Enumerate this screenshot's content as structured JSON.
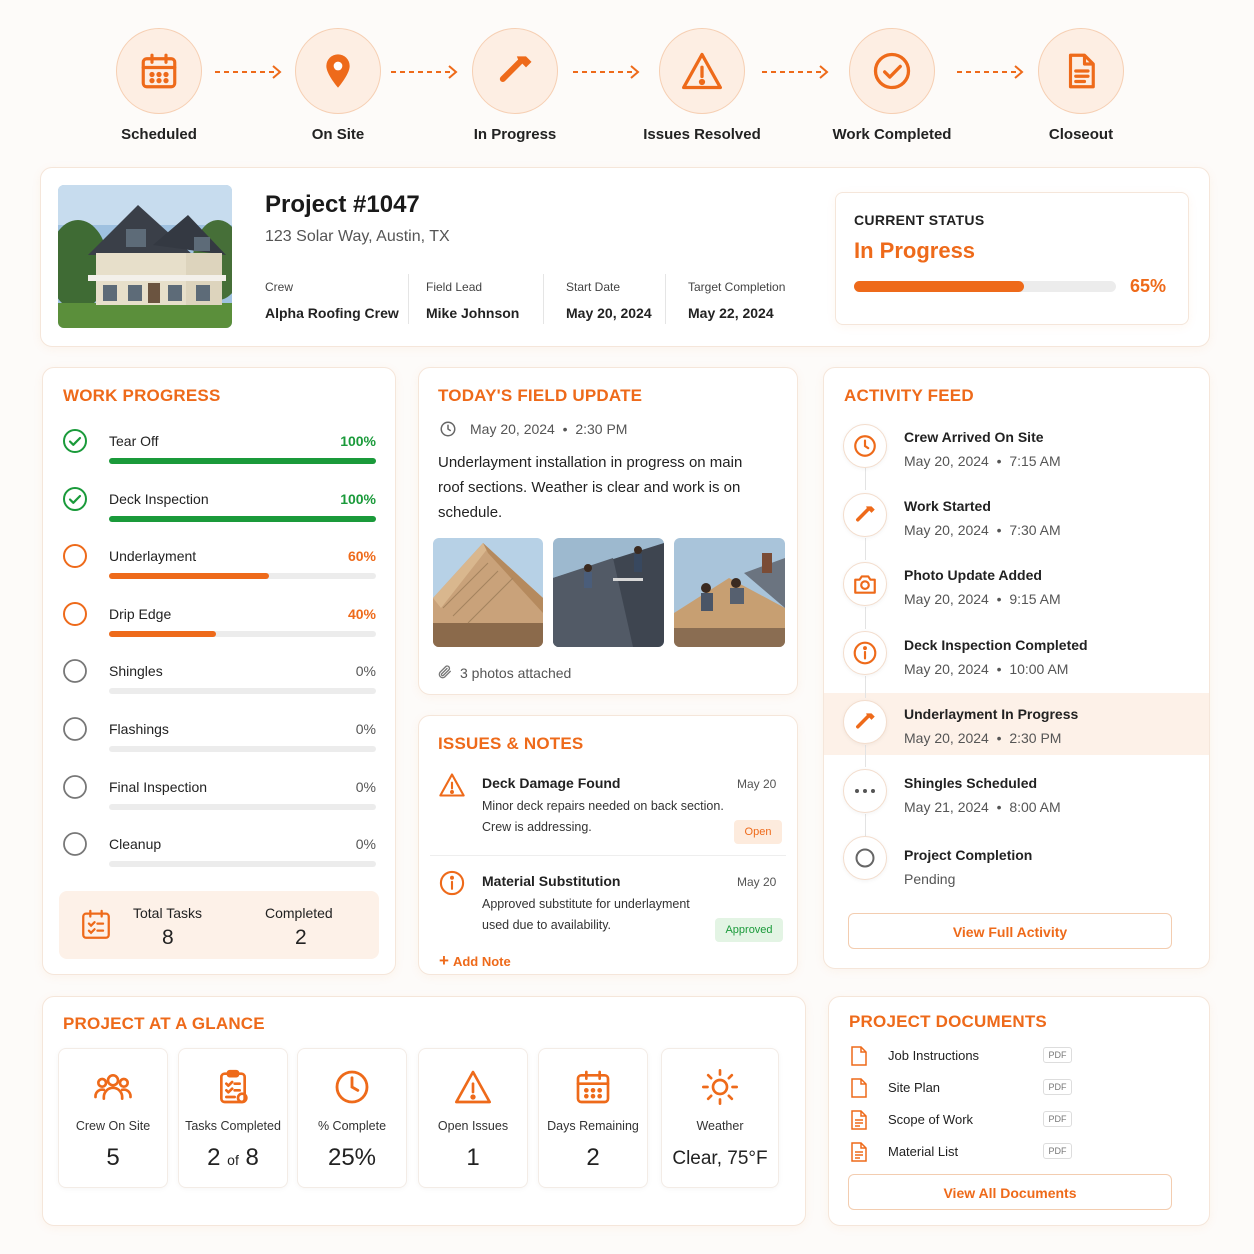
{
  "colors": {
    "accent": "#ee6a1a",
    "success": "#1a9a3a",
    "track": "#ececec"
  },
  "stepper": [
    {
      "label": "Scheduled",
      "icon": "calendar-icon"
    },
    {
      "label": "On Site",
      "icon": "map-pin-icon"
    },
    {
      "label": "In Progress",
      "icon": "hammer-icon"
    },
    {
      "label": "Issues Resolved",
      "icon": "warning-icon"
    },
    {
      "label": "Work Completed",
      "icon": "check-circle-icon"
    },
    {
      "label": "Closeout",
      "icon": "document-icon"
    }
  ],
  "project": {
    "title": "Project #1047",
    "address": "123 Solar Way, Austin, TX",
    "meta": [
      {
        "label": "Crew",
        "value": "Alpha Roofing Crew"
      },
      {
        "label": "Field Lead",
        "value": "Mike Johnson"
      },
      {
        "label": "Start Date",
        "value": "May 20, 2024"
      },
      {
        "label": "Target Completion",
        "value": "May 22, 2024"
      }
    ]
  },
  "status": {
    "heading": "CURRENT STATUS",
    "value": "In Progress",
    "percent_label": "65%",
    "progress": 65
  },
  "work_progress": {
    "title": "WORK PROGRESS",
    "tasks": [
      {
        "name": "Tear Off",
        "pct_label": "100%",
        "pct": 100,
        "state": "done"
      },
      {
        "name": "Deck Inspection",
        "pct_label": "100%",
        "pct": 100,
        "state": "done"
      },
      {
        "name": "Underlayment",
        "pct_label": "60%",
        "pct": 60,
        "state": "active"
      },
      {
        "name": "Drip Edge",
        "pct_label": "40%",
        "pct": 40,
        "state": "active"
      },
      {
        "name": "Shingles",
        "pct_label": "0%",
        "pct": 0,
        "state": "todo"
      },
      {
        "name": "Flashings",
        "pct_label": "0%",
        "pct": 0,
        "state": "todo"
      },
      {
        "name": "Final Inspection",
        "pct_label": "0%",
        "pct": 0,
        "state": "todo"
      },
      {
        "name": "Cleanup",
        "pct_label": "0%",
        "pct": 0,
        "state": "todo"
      }
    ],
    "summary": {
      "total_label": "Total Tasks",
      "total_value": "8",
      "completed_label": "Completed",
      "completed_value": "2"
    }
  },
  "field_update": {
    "title": "TODAY'S FIELD UPDATE",
    "date": "May 20, 2024",
    "time": "2:30 PM",
    "body": "Underlayment installation in progress on main roof sections. Weather is clear and work is on schedule.",
    "attachments": "3 photos attached"
  },
  "issues": {
    "title": "ISSUES & NOTES",
    "items": [
      {
        "title": "Deck Damage Found",
        "date": "May 20",
        "line1": "Minor deck repairs needed on back section.",
        "line2": "Crew is addressing.",
        "badge": "Open",
        "icon": "warning-icon"
      },
      {
        "title": "Material Substitution",
        "date": "May 20",
        "line1": "Approved substitute for underlayment",
        "line2": "used due to availability.",
        "badge": "Approved",
        "icon": "info-icon"
      }
    ],
    "add_note": "Add Note"
  },
  "activity": {
    "title": "ACTIVITY FEED",
    "items": [
      {
        "title": "Crew Arrived On Site",
        "date": "May 20, 2024",
        "time": "7:15 AM",
        "icon": "clock-icon"
      },
      {
        "title": "Work Started",
        "date": "May 20, 2024",
        "time": "7:30 AM",
        "icon": "hammer-icon"
      },
      {
        "title": "Photo Update Added",
        "date": "May 20, 2024",
        "time": "9:15 AM",
        "icon": "camera-icon"
      },
      {
        "title": "Deck Inspection Completed",
        "date": "May 20, 2024",
        "time": "10:00 AM",
        "icon": "info-icon"
      },
      {
        "title": "Underlayment In Progress",
        "date": "May 20, 2024",
        "time": "2:30 PM",
        "icon": "hammer-icon"
      },
      {
        "title": "Shingles Scheduled",
        "date": "May 21, 2024",
        "time": "8:00 AM",
        "icon": "more-icon"
      },
      {
        "title": "Project Completion",
        "status": "Pending",
        "icon": "circle-icon"
      }
    ],
    "button": "View Full Activity"
  },
  "glance": {
    "title": "PROJECT AT A GLANCE",
    "items": [
      {
        "label": "Crew On Site",
        "value": "5",
        "icon": "users-icon"
      },
      {
        "label": "Tasks Completed",
        "value_a": "2",
        "value_of": "of",
        "value_b": "8",
        "icon": "clipboard-icon"
      },
      {
        "label": "% Complete",
        "value": "25%",
        "icon": "clock-icon"
      },
      {
        "label": "Open Issues",
        "value": "1",
        "icon": "warning-icon"
      },
      {
        "label": "Days Remaining",
        "value": "2",
        "icon": "calendar-icon"
      },
      {
        "label": "Weather",
        "value": "Clear, 75°F",
        "icon": "sun-icon"
      }
    ]
  },
  "documents": {
    "title": "PROJECT DOCUMENTS",
    "items": [
      {
        "name": "Job Instructions",
        "type": "PDF"
      },
      {
        "name": "Site Plan",
        "type": "PDF"
      },
      {
        "name": "Scope of Work",
        "type": "PDF"
      },
      {
        "name": "Material List",
        "type": "PDF"
      }
    ],
    "button": "View All Documents"
  }
}
